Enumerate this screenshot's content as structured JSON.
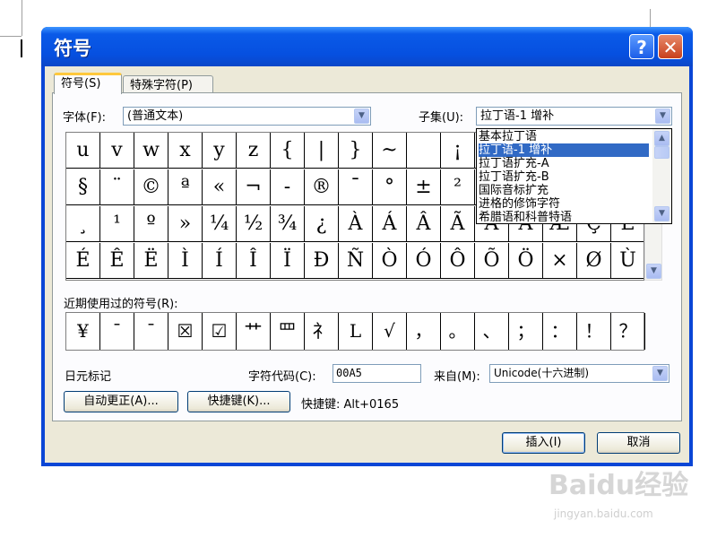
{
  "window": {
    "title": "符号",
    "help_label": "?",
    "close_label": "✕"
  },
  "tabs": [
    {
      "label": "符号(S)"
    },
    {
      "label": "特殊字符(P)"
    }
  ],
  "font": {
    "label": "字体(F):",
    "value": "(普通文本)"
  },
  "subset": {
    "label": "子集(U):",
    "value": "拉丁语-1 增补",
    "options": [
      "基本拉丁语",
      "拉丁语-1 增补",
      "拉丁语扩充-A",
      "拉丁语扩充-B",
      "国际音标扩充",
      "进格的修饰字符",
      "希腊语和科普特语"
    ],
    "selected_index": 1
  },
  "symbol_grid": {
    "rows": [
      [
        "u",
        "v",
        "w",
        "x",
        "y",
        "z",
        "{",
        "|",
        "}",
        "~",
        "",
        "¡",
        "",
        "",
        "",
        "",
        "",
        ""
      ],
      [
        "§",
        "¨",
        "©",
        "ª",
        "«",
        "¬",
        "-",
        "®",
        "¯",
        "°",
        "±",
        "²",
        "",
        "",
        "",
        "",
        "",
        ""
      ],
      [
        "¸",
        "¹",
        "º",
        "»",
        "¼",
        "½",
        "¾",
        "¿",
        "À",
        "Á",
        "Â",
        "Ã",
        "Ä",
        "Å",
        "Æ",
        "Ç",
        "È"
      ],
      [
        "É",
        "Ê",
        "Ë",
        "Ì",
        "Í",
        "Î",
        "Ï",
        "Ð",
        "Ñ",
        "Ò",
        "Ó",
        "Ô",
        "Õ",
        "Ö",
        "×",
        "Ø",
        "Ù"
      ]
    ]
  },
  "recent": {
    "label": "近期使用过的符号(R):",
    "items": [
      "¥",
      "¯",
      "¯",
      "☒",
      "☑",
      "艹",
      "罒",
      "礻",
      "L",
      "√",
      "，",
      "。",
      "、",
      "；",
      "：",
      "！",
      "？"
    ]
  },
  "char_name": "日元标记",
  "char_code": {
    "label": "字符代码(C):",
    "value": "00A5"
  },
  "from": {
    "label": "来自(M):",
    "value": "Unicode(十六进制)"
  },
  "buttons": {
    "autocorrect": "自动更正(A)...",
    "shortcut_key": "快捷键(K)...",
    "shortcut_info": "快捷键: Alt+0165",
    "insert": "插入(I)",
    "cancel": "取消"
  },
  "watermark": {
    "brand": "Baidu经验",
    "url": "jingyan.baidu.com"
  }
}
